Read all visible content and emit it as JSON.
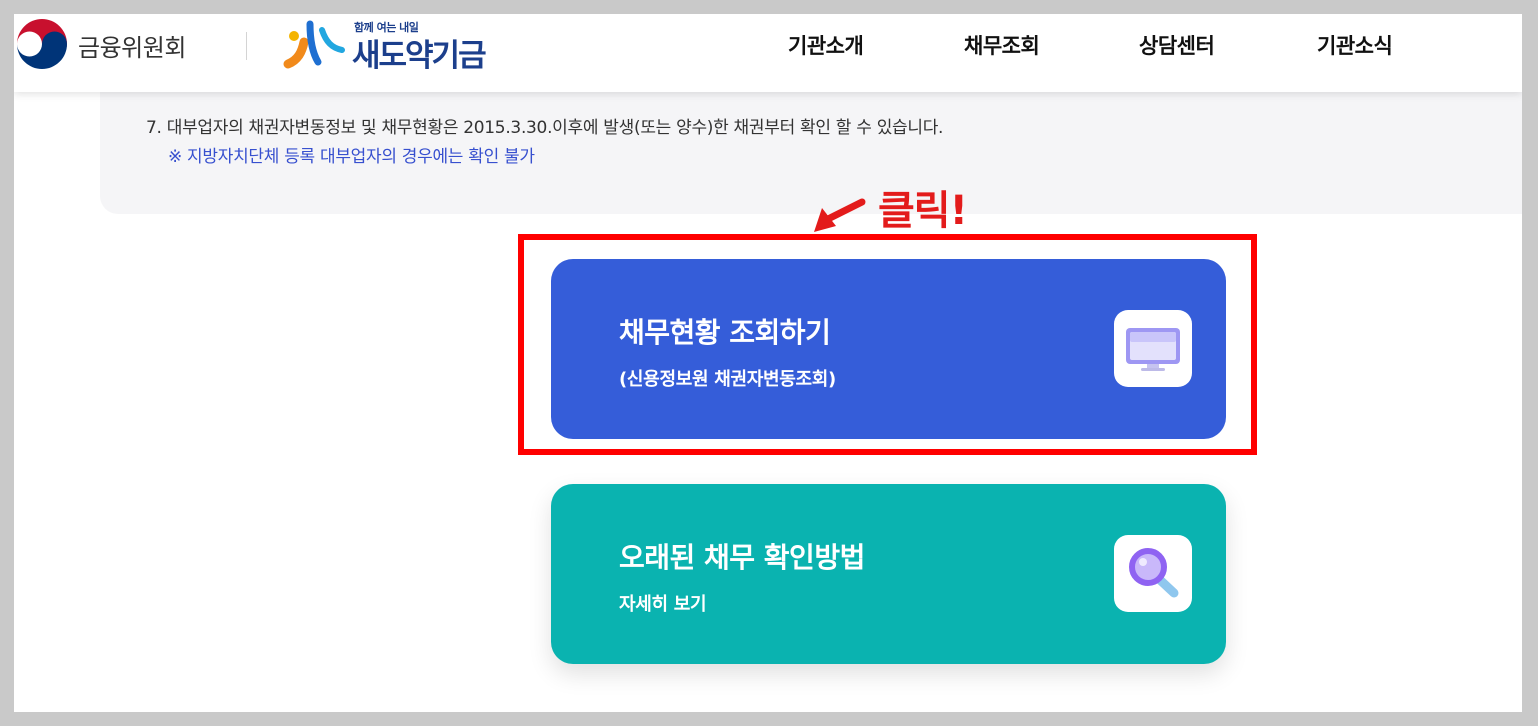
{
  "header": {
    "org_name": "금융위원회",
    "brand_tagline": "함께 여는 내일",
    "brand_name": "새도약기금",
    "nav": [
      "기관소개",
      "채무조회",
      "상담센터",
      "기관소식"
    ]
  },
  "info": {
    "line": "7.  대부업자의 채권자변동정보 및 채무현황은 2015.3.30.이후에 발생(또는 양수)한 채권부터 확인 할 수 있습니다.",
    "note": "※ 지방자치단체 등록 대부업자의 경우에는 확인 불가"
  },
  "annotation": {
    "click_label": "클릭!"
  },
  "cards": [
    {
      "title": "채무현황 조회하기",
      "subtitle": "(신용정보원 채권자변동조회)",
      "icon": "monitor-icon",
      "color": "#355dd9"
    },
    {
      "title": "오래된 채무 확인방법",
      "subtitle": "자세히 보기",
      "icon": "magnifier-icon",
      "color": "#0ab3b0"
    }
  ],
  "colors": {
    "annotation_red": "#e31b1b",
    "info_note_blue": "#3750cf",
    "brand_navy": "#1c3f8c"
  }
}
